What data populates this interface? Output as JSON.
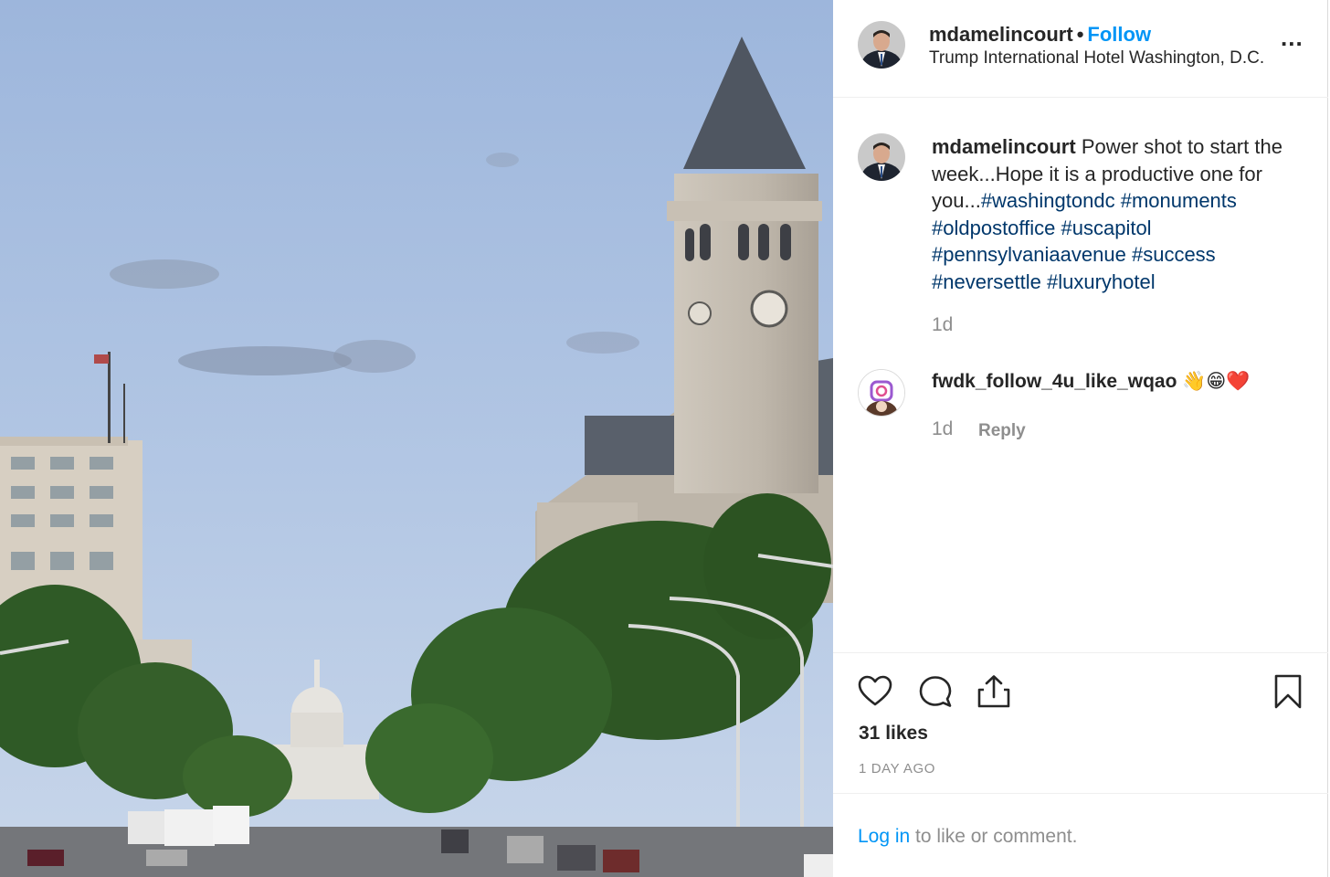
{
  "post": {
    "username": "mdamelincourt",
    "separator": "•",
    "follow_label": "Follow",
    "location": "Trump International Hotel Washington, D.C.",
    "more_label": "..."
  },
  "caption": {
    "username": "mdamelincourt",
    "text": "Power shot to start the week...Hope it is a productive one for you...",
    "hashtags": [
      "#washingtondc",
      "#monuments",
      "#oldpostoffice",
      "#uscapitol",
      "#pennsylvaniaavenue",
      "#success",
      "#neversettle",
      "#luxuryhotel"
    ],
    "time": "1d"
  },
  "comment": {
    "username": "fwdk_follow_4u_like_wqao",
    "text": "👋😁❤️",
    "time": "1d",
    "reply_label": "Reply"
  },
  "actions": {
    "icons": [
      "heart-icon",
      "comment-icon",
      "share-icon",
      "bookmark-icon"
    ],
    "likes": "31 likes",
    "posted_ago": "1 DAY AGO"
  },
  "login": {
    "link_label": "Log in",
    "suffix": " to like or comment."
  },
  "colors": {
    "link_blue": "#0095f6",
    "hashtag_blue": "#00376b",
    "muted": "#8e8e8e",
    "text": "#262626"
  }
}
